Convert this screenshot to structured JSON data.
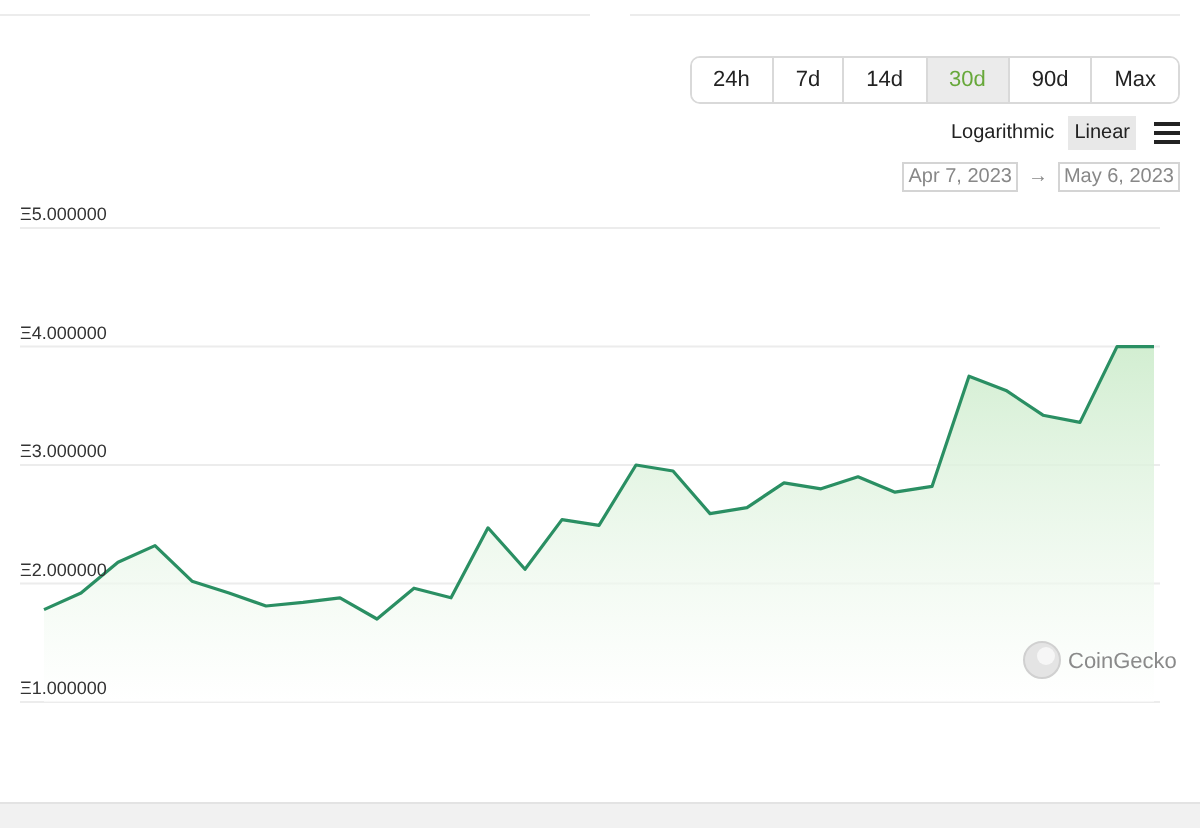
{
  "ranges": [
    {
      "label": "24h",
      "selected": false
    },
    {
      "label": "7d",
      "selected": false
    },
    {
      "label": "14d",
      "selected": false
    },
    {
      "label": "30d",
      "selected": true
    },
    {
      "label": "90d",
      "selected": false
    },
    {
      "label": "Max",
      "selected": false
    }
  ],
  "scales": [
    {
      "label": "Logarithmic",
      "selected": false
    },
    {
      "label": "Linear",
      "selected": true
    }
  ],
  "date_range": {
    "from": "Apr 7, 2023",
    "arrow": "→",
    "to": "May 6, 2023"
  },
  "chart": {
    "watermark": "CoinGecko",
    "y_axis_labels": [
      "Ξ5.000000",
      "Ξ4.000000",
      "Ξ3.000000",
      "Ξ2.000000",
      "Ξ1.000000"
    ]
  }
}
